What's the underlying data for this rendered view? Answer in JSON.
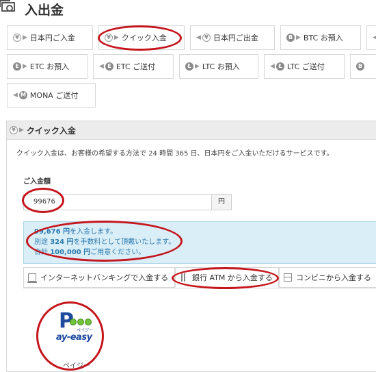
{
  "page": {
    "title": "入出金",
    "icon": "money-icon"
  },
  "nav": {
    "row1": [
      {
        "name": "nav-jpy-deposit",
        "label": "日本円ご入金",
        "icon": "yen-in-icon"
      },
      {
        "name": "nav-quick-deposit",
        "label": "クイック入金",
        "icon": "yen-quick-icon"
      },
      {
        "name": "nav-jpy-withdraw",
        "label": "日本円ご出金",
        "icon": "yen-out-icon"
      },
      {
        "name": "nav-btc-deposit",
        "label": "BTC お預入",
        "icon": "btc-in-icon"
      }
    ],
    "row2": [
      {
        "name": "nav-etc-deposit",
        "label": "ETC お預入",
        "icon": "etc-in-icon"
      },
      {
        "name": "nav-etc-send",
        "label": "ETC ご送付",
        "icon": "etc-out-icon"
      },
      {
        "name": "nav-ltc-deposit",
        "label": "LTC お預入",
        "icon": "ltc-in-icon"
      },
      {
        "name": "nav-ltc-send",
        "label": "LTC ご送付",
        "icon": "ltc-out-icon"
      }
    ],
    "row3": [
      {
        "name": "nav-mona-send",
        "label": "MONA ご送付",
        "icon": "mona-out-icon"
      }
    ],
    "icon_letters": {
      "yen": "¥",
      "btc": "B",
      "etc": "E",
      "ltc": "Ł",
      "mona": "M"
    }
  },
  "quick": {
    "title": "クイック入金",
    "description": "クイック入金は、お客様の希望する方法で 24 時間 365 日、日本円をご入金いただけるサービスです。",
    "amount_label": "ご入金額",
    "amount_value": "99676",
    "unit": "円",
    "info": {
      "line1_amount": "99,676 円",
      "line1_rest": "を入金します。",
      "line2_pre": "別途 ",
      "line2_amount": "324 円",
      "line2_rest": "を手数料として頂戴いたします。",
      "line3_pre": "合計 ",
      "line3_amount": "100,000 円",
      "line3_rest": "ご用意ください。"
    },
    "tabs": [
      {
        "label": "インターネットバンキングで入金する",
        "icon": "computer-icon"
      },
      {
        "label": "銀行 ATM から入金する",
        "icon": "atm-icon"
      },
      {
        "label": "コンビニから入金する",
        "icon": "store-icon"
      }
    ],
    "payeasy": {
      "logo_text": "ay-easy",
      "logo_letter": "P",
      "logo_small": "ペイジー",
      "caption": "ペイジー"
    }
  },
  "colors": {
    "highlight": "#c4161c",
    "info_bg": "#d9eef7",
    "info_text": "#2c7bb0",
    "brand_blue": "#1e4aa0",
    "brand_green": "#6fc23a"
  }
}
